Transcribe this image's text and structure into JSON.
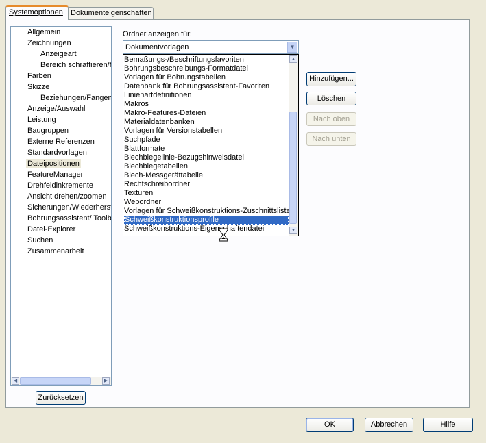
{
  "tabs": [
    {
      "label": "Systemoptionen",
      "active": true
    },
    {
      "label": "Dokumenteigenschaften",
      "active": false
    }
  ],
  "tree": {
    "items": [
      {
        "label": "Allgemein"
      },
      {
        "label": "Zeichnungen"
      },
      {
        "label": "Anzeigeart"
      },
      {
        "label": "Bereich schraffieren/f"
      },
      {
        "label": "Farben"
      },
      {
        "label": "Skizze"
      },
      {
        "label": "Beziehungen/Fangen"
      },
      {
        "label": "Anzeige/Auswahl"
      },
      {
        "label": "Leistung"
      },
      {
        "label": "Baugruppen"
      },
      {
        "label": "Externe Referenzen"
      },
      {
        "label": "Standardvorlagen"
      },
      {
        "label": "Dateipositionen"
      },
      {
        "label": "FeatureManager"
      },
      {
        "label": "Drehfeldinkremente"
      },
      {
        "label": "Ansicht drehen/zoomen"
      },
      {
        "label": "Sicherungen/Wiederherst"
      },
      {
        "label": "Bohrungsassistent/ Toolb"
      },
      {
        "label": "Datei-Explorer"
      },
      {
        "label": "Suchen"
      },
      {
        "label": "Zusammenarbeit"
      }
    ],
    "selected": "Dateipositionen"
  },
  "reset_button": "Zurücksetzen",
  "folder_label": "Ordner anzeigen für:",
  "combo_value": "Dokumentvorlagen",
  "list_items": [
    "Bemaßungs-/Beschriftungsfavoriten",
    "Bohrungsbeschreibungs-Formatdatei",
    "Vorlagen für Bohrungstabellen",
    "Datenbank für Bohrungsassistent-Favoriten",
    "Linienartdefinitionen",
    "Makros",
    "Makro-Features-Dateien",
    "Materialdatenbanken",
    "Vorlagen für Versionstabellen",
    "Suchpfade",
    "Blattformate",
    "Blechbiegelinie-Bezugshinweisdatei",
    "Blechbiegetabellen",
    "Blech-Messgerättabelle",
    "Rechtschreibordner",
    "Texturen",
    "Webordner",
    "Vorlagen für Schweißkonstruktions-Zuschnittslisten",
    "Schweißkonstruktionsprofile",
    "Schweißkonstruktions-Eigenschaftendatei"
  ],
  "selected_list_item": "Schweißkonstruktionsprofile",
  "buttons": {
    "add": "Hinzufügen...",
    "delete": "Löschen",
    "move_up": "Nach oben",
    "move_down": "Nach unten",
    "ok": "OK",
    "cancel": "Abbrechen",
    "help": "Hilfe"
  },
  "colors": {
    "selection": "#316ac5",
    "dialog_bg": "#ece9d8",
    "tab_highlight": "#e68b2c"
  }
}
